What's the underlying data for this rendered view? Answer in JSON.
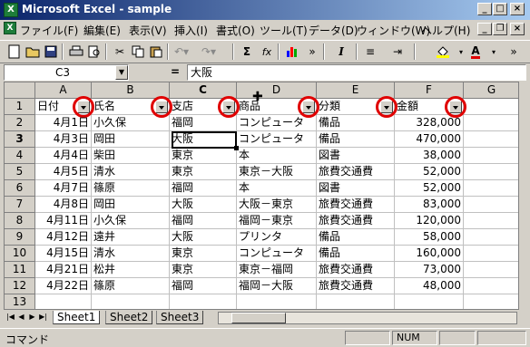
{
  "window": {
    "title": "Microsoft Excel - sample",
    "app_icon_letter": "X"
  },
  "menu": [
    "ファイル(F)",
    "編集(E)",
    "表示(V)",
    "挿入(I)",
    "書式(O)",
    "ツール(T)",
    "データ(D)",
    "ウィンドウ(W)",
    "ヘルプ(H)"
  ],
  "toolbar": {
    "sum": "Σ",
    "fx": "fx",
    "italic": "I"
  },
  "formula_bar": {
    "name_box": "C3",
    "equals": "=",
    "value": "大阪"
  },
  "columns": [
    "A",
    "B",
    "C",
    "D",
    "E",
    "F",
    "G"
  ],
  "header_row": [
    "日付",
    "氏名",
    "支店",
    "商品",
    "分類",
    "金額"
  ],
  "rows": [
    [
      "4月1日",
      "小久保",
      "福岡",
      "コンピュータ",
      "備品",
      "328,000"
    ],
    [
      "4月3日",
      "岡田",
      "大阪",
      "コンピュータ",
      "備品",
      "470,000"
    ],
    [
      "4月4日",
      "柴田",
      "東京",
      "本",
      "図書",
      "38,000"
    ],
    [
      "4月5日",
      "清水",
      "東京",
      "東京－大阪",
      "旅費交通費",
      "52,000"
    ],
    [
      "4月7日",
      "篠原",
      "福岡",
      "本",
      "図書",
      "52,000"
    ],
    [
      "4月8日",
      "岡田",
      "大阪",
      "大阪－東京",
      "旅費交通費",
      "83,000"
    ],
    [
      "4月11日",
      "小久保",
      "福岡",
      "福岡－東京",
      "旅費交通費",
      "120,000"
    ],
    [
      "4月12日",
      "遠井",
      "大阪",
      "プリンタ",
      "備品",
      "58,000"
    ],
    [
      "4月15日",
      "清水",
      "東京",
      "コンピュータ",
      "備品",
      "160,000"
    ],
    [
      "4月21日",
      "松井",
      "東京",
      "東京－福岡",
      "旅費交通費",
      "73,000"
    ],
    [
      "4月22日",
      "篠原",
      "福岡",
      "福岡－大阪",
      "旅費交通費",
      "48,000"
    ]
  ],
  "row_numbers": [
    "1",
    "2",
    "3",
    "4",
    "5",
    "6",
    "7",
    "8",
    "9",
    "10",
    "11",
    "12",
    "13"
  ],
  "sheets": [
    "Sheet1",
    "Sheet2",
    "Sheet3"
  ],
  "status": {
    "mode": "コマンド",
    "num": "NUM"
  }
}
